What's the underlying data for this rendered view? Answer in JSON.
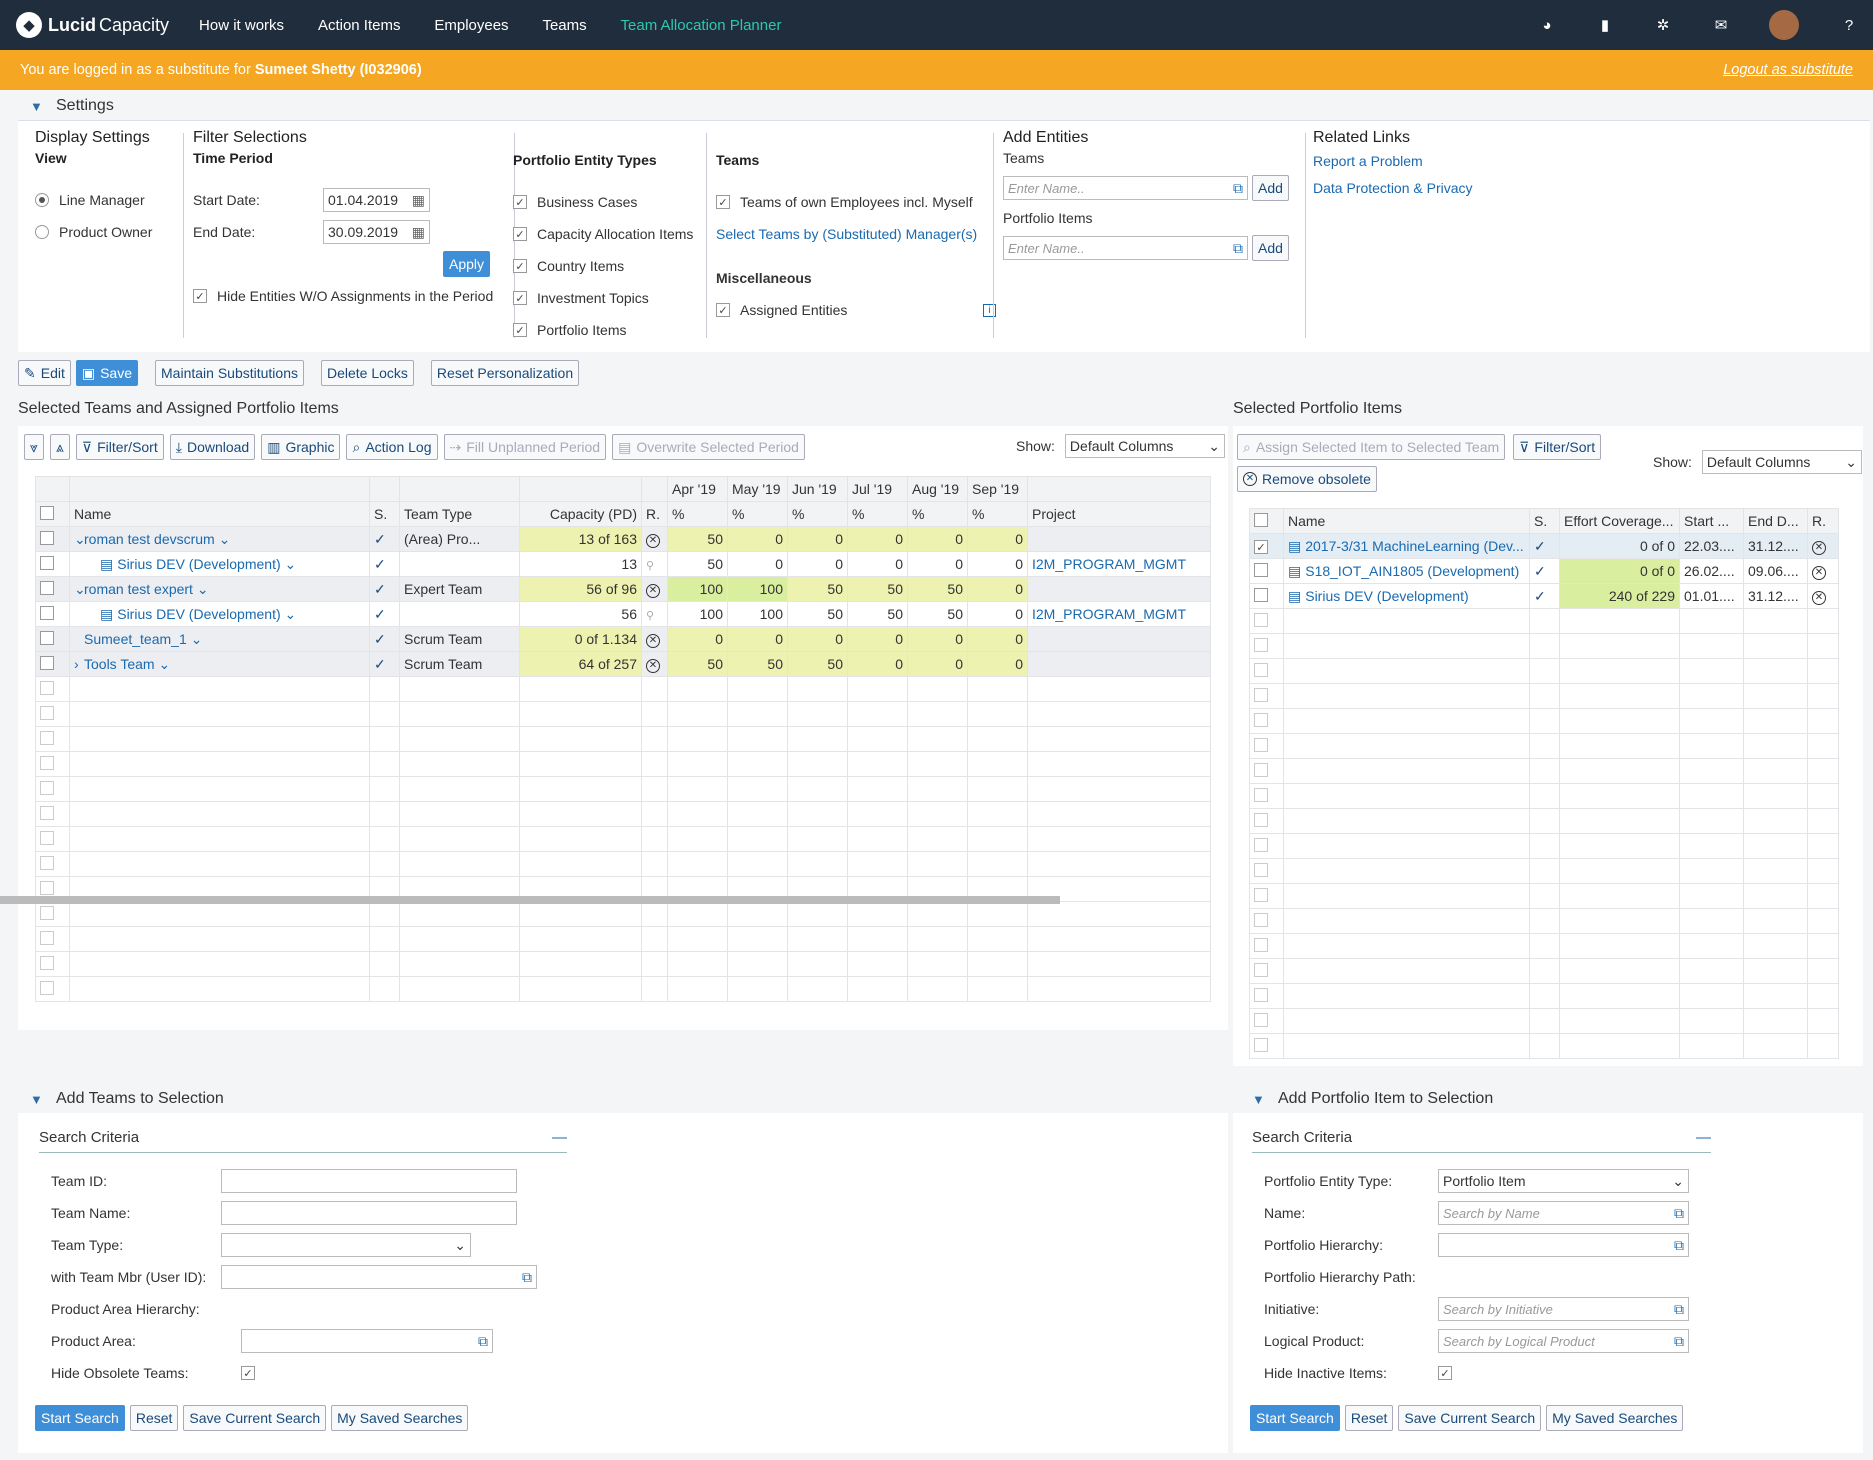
{
  "app": {
    "logo_bold": "Lucid",
    "logo_rest": "Capacity"
  },
  "nav": [
    "How it works",
    "Action Items",
    "Employees",
    "Teams",
    "Team Allocation Planner"
  ],
  "substitute": {
    "text": "You are logged in as a substitute for",
    "name": "Sumeet Shetty (I032906)",
    "logout": "Logout as substitute"
  },
  "settings": {
    "title": "Settings",
    "display": {
      "title": "Display Settings",
      "view": "View",
      "opt1": "Line Manager",
      "opt2": "Product Owner"
    },
    "filter": {
      "title": "Filter Selections",
      "period": "Time Period",
      "start_label": "Start Date:",
      "start": "01.04.2019",
      "end_label": "End Date:",
      "end": "30.09.2019",
      "apply": "Apply",
      "hide": "Hide Entities W/O Assignments in the Period"
    },
    "types": {
      "title": "Portfolio Entity Types",
      "items": [
        "Business Cases",
        "Capacity Allocation Items",
        "Country Items",
        "Investment Topics",
        "Portfolio Items"
      ]
    },
    "teams": {
      "title": "Teams",
      "own": "Teams of own Employees incl. Myself",
      "select": "Select Teams by (Substituted) Manager(s)",
      "misc": "Miscellaneous",
      "assigned": "Assigned Entities"
    },
    "add": {
      "title": "Add Entities",
      "teams": "Teams",
      "placeholder": "Enter Name..",
      "add": "Add",
      "portfolio": "Portfolio Items"
    },
    "related": {
      "title": "Related Links",
      "l1": "Report a Problem",
      "l2": "Data Protection & Privacy"
    }
  },
  "toolbar": {
    "edit": "Edit",
    "save": "Save",
    "subs": "Maintain Substitutions",
    "locks": "Delete Locks",
    "reset": "Reset Personalization"
  },
  "left": {
    "title": "Selected Teams and Assigned Portfolio Items",
    "filter": "Filter/Sort",
    "download": "Download",
    "graphic": "Graphic",
    "log": "Action Log",
    "fill": "Fill Unplanned Period",
    "overwrite": "Overwrite Selected Period",
    "show": "Show:",
    "columns": "Default Columns",
    "months": [
      "Apr '19",
      "May '19",
      "Jun '19",
      "Jul '19",
      "Aug '19",
      "Sep '19"
    ],
    "headers": {
      "name": "Name",
      "s": "S.",
      "type": "Team Type",
      "cap": "Capacity (PD)",
      "r": "R.",
      "pct": "%",
      "project": "Project"
    },
    "rows": [
      {
        "name": "roman test devscrum",
        "indent": 0,
        "exp": "v",
        "team": true,
        "type": "(Area) Pro...",
        "cap": "13 of 163",
        "m": [
          "50",
          "0",
          "0",
          "0",
          "0",
          "0"
        ],
        "proj": ""
      },
      {
        "name": "Sirius DEV (Development)",
        "indent": 1,
        "exp": "",
        "team": false,
        "type": "",
        "cap": "13",
        "m": [
          "50",
          "0",
          "0",
          "0",
          "0",
          "0"
        ],
        "proj": "I2M_PROGRAM_MGMT"
      },
      {
        "name": "roman test expert",
        "indent": 0,
        "exp": "v",
        "team": true,
        "type": "Expert Team",
        "cap": "56 of 96",
        "m": [
          "100",
          "100",
          "50",
          "50",
          "50",
          "0"
        ],
        "proj": ""
      },
      {
        "name": "Sirius DEV (Development)",
        "indent": 1,
        "exp": "",
        "team": false,
        "type": "",
        "cap": "56",
        "m": [
          "100",
          "100",
          "50",
          "50",
          "50",
          "0"
        ],
        "proj": "I2M_PROGRAM_MGMT"
      },
      {
        "name": "Sumeet_team_1",
        "indent": 0,
        "exp": " ",
        "team": true,
        "type": "Scrum Team",
        "cap": "0 of 1.134",
        "m": [
          "0",
          "0",
          "0",
          "0",
          "0",
          "0"
        ],
        "proj": ""
      },
      {
        "name": "Tools Team",
        "indent": 0,
        "exp": ">",
        "team": true,
        "type": "Scrum Team",
        "cap": "64 of 257",
        "m": [
          "50",
          "50",
          "50",
          "0",
          "0",
          "0"
        ],
        "proj": ""
      }
    ]
  },
  "right": {
    "title": "Selected Portfolio Items",
    "assign": "Assign Selected Item to Selected Team",
    "filter": "Filter/Sort",
    "remove": "Remove obsolete",
    "show": "Show:",
    "columns": "Default Columns",
    "headers": {
      "name": "Name",
      "s": "S.",
      "eff": "Effort Coverage...",
      "start": "Start ...",
      "end": "End D...",
      "r": "R."
    },
    "rows": [
      {
        "name": "2017-3/31 MachineLearning (Dev...",
        "eff": "0 of 0",
        "start": "22.03....",
        "end": "31.12....",
        "sel": true
      },
      {
        "name": "S18_IOT_AIN1805 (Development)",
        "eff": "0 of 0",
        "start": "26.02....",
        "end": "09.06....",
        "sel": false
      },
      {
        "name": "Sirius DEV (Development)",
        "eff": "240 of 229",
        "start": "01.01....",
        "end": "31.12....",
        "sel": false
      }
    ]
  },
  "add_teams": {
    "title": "Add Teams to Selection",
    "criteria": "Search Criteria",
    "fields": [
      "Team ID:",
      "Team Name:",
      "Team Type:",
      "with Team Mbr (User ID):",
      "Product Area Hierarchy:",
      "Product Area:",
      "Hide Obsolete Teams:"
    ]
  },
  "add_portfolio": {
    "title": "Add Portfolio Item to Selection",
    "criteria": "Search Criteria",
    "fields": [
      "Portfolio Entity Type:",
      "Name:",
      "Portfolio Hierarchy:",
      "Portfolio Hierarchy Path:",
      "Initiative:",
      "Logical Product:",
      "Hide Inactive Items:"
    ],
    "type_val": "Portfolio Item",
    "name_ph": "Search by Name",
    "init_ph": "Search by Initiative",
    "lp_ph": "Search by Logical Product"
  },
  "search_buttons": {
    "start": "Start Search",
    "reset": "Reset",
    "save": "Save Current Search",
    "saved": "My Saved Searches"
  }
}
